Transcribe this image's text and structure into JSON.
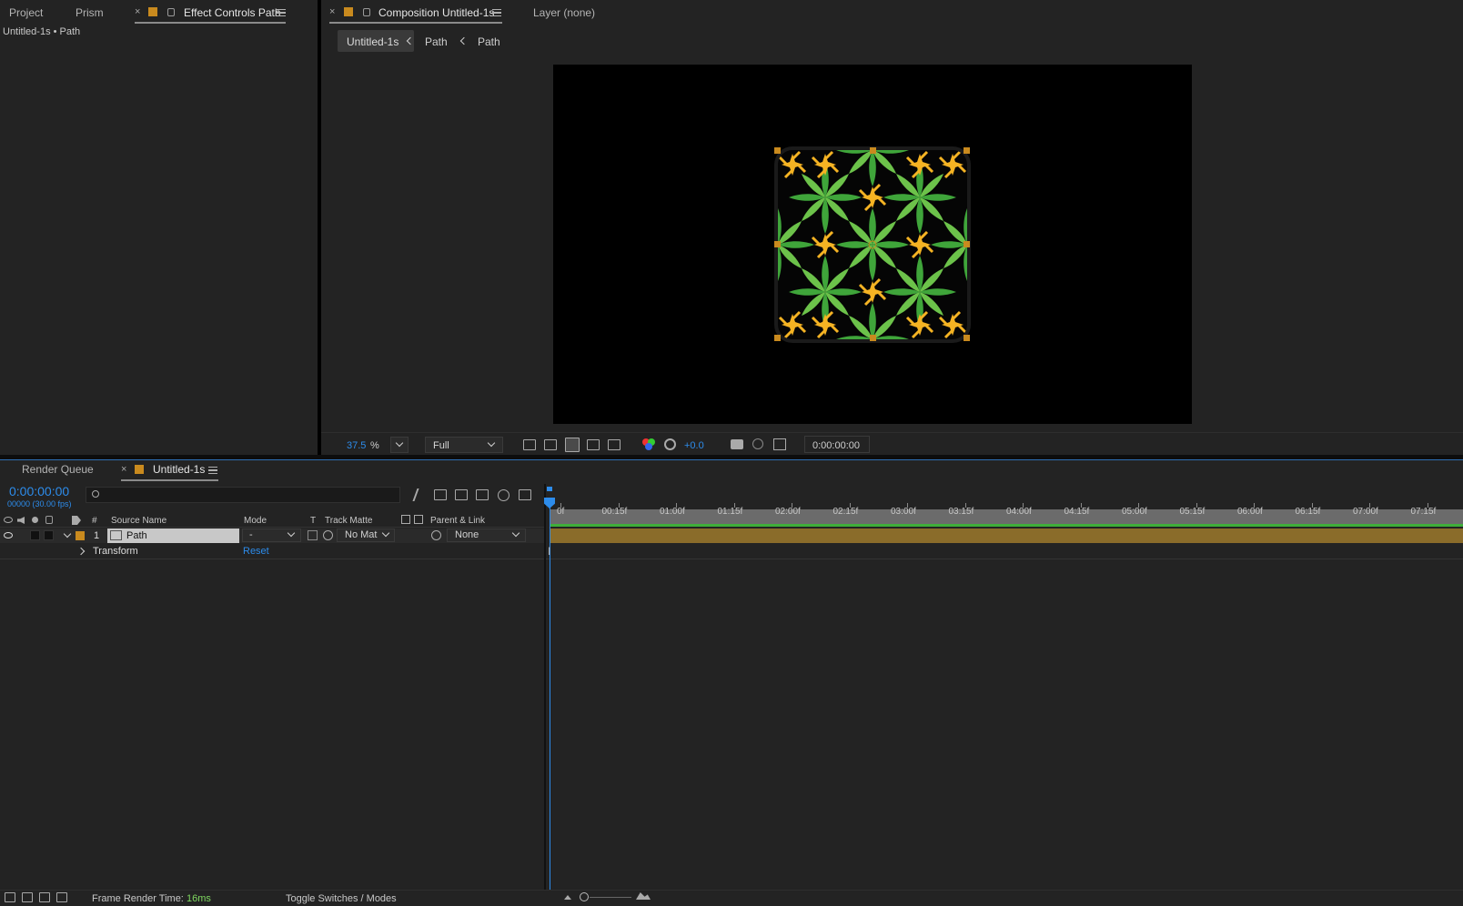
{
  "left_panel": {
    "tabs": [
      {
        "label": "Project"
      },
      {
        "label": "Prism"
      },
      {
        "label": "Effect Controls Path"
      }
    ],
    "subtitle": "Untitled-1s • Path"
  },
  "viewer": {
    "tab_label": "Composition Untitled-1s",
    "layer_tab": "Layer (none)",
    "breadcrumbs": [
      "Untitled-1s",
      "Path",
      "Path"
    ],
    "zoom_value": "37.5",
    "zoom_unit": "%",
    "resolution": "Full",
    "exposure": "+0.0",
    "timecode": "0:00:00:00"
  },
  "timeline": {
    "tabs": [
      {
        "label": "Render Queue"
      },
      {
        "label": "Untitled-1s"
      }
    ],
    "current_time": "0:00:00:00",
    "frame_info": "00000 (30.00 fps)",
    "search_placeholder": "",
    "columns": {
      "num": "#",
      "source_name": "Source Name",
      "mode": "Mode",
      "t": "T",
      "track_matte": "Track Matte",
      "parent_link": "Parent & Link"
    },
    "layer": {
      "index": "1",
      "name": "Path",
      "mode": "-",
      "track_matte": "No Mat",
      "parent": "None"
    },
    "transform_label": "Transform",
    "reset_label": "Reset",
    "ruler_labels": [
      "0f",
      "00:15f",
      "01:00f",
      "01:15f",
      "02:00f",
      "02:15f",
      "03:00f",
      "03:15f",
      "04:00f",
      "04:15f",
      "05:00f",
      "05:15f",
      "06:00f",
      "06:15f",
      "07:00f",
      "07:15f"
    ]
  },
  "status_bar": {
    "frame_render_label": "Frame Render Time:",
    "frame_render_value": "16ms",
    "toggle_label": "Toggle Switches / Modes"
  },
  "colors": {
    "accent_blue": "#2d8ceb",
    "label_orange": "#c98a1e",
    "layer_bar": "#8a6c2a",
    "green_bar": "#3fae3a"
  }
}
